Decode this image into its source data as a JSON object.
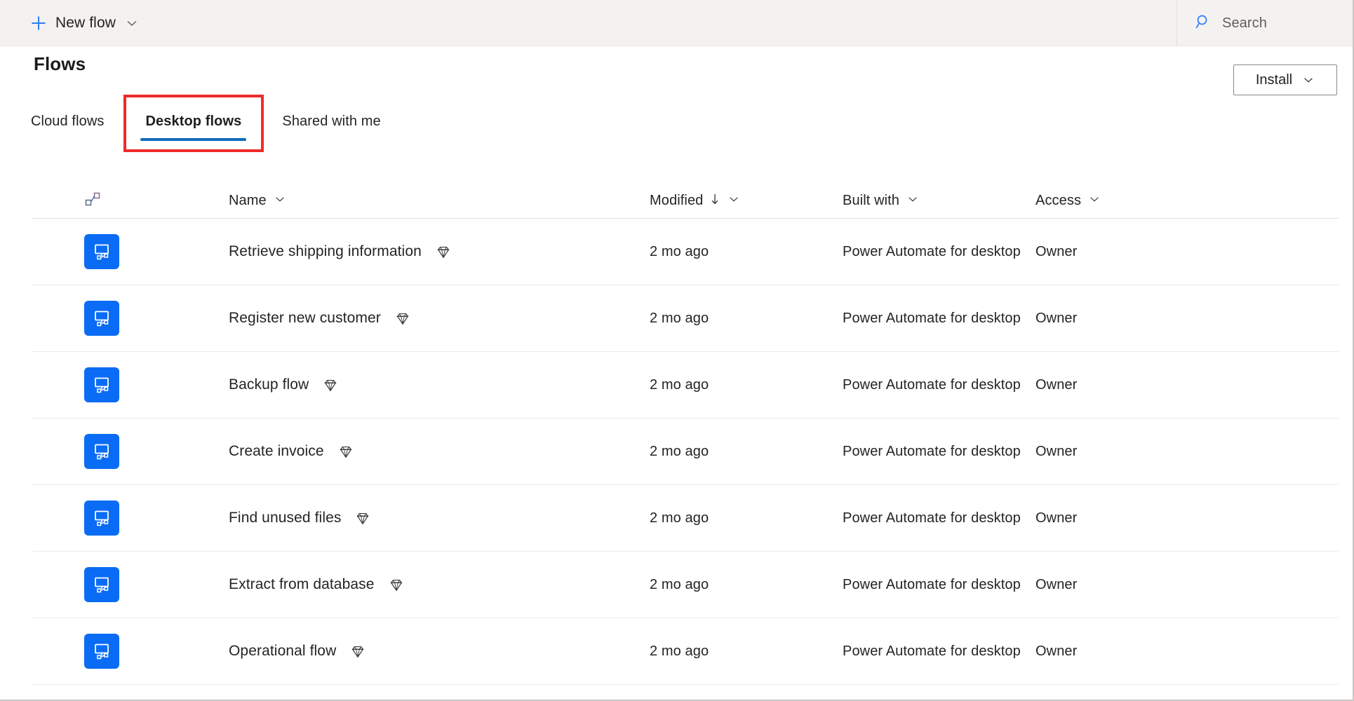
{
  "commandbar": {
    "new_flow_label": "New flow",
    "new_flow_icon": "plus-icon",
    "new_flow_chevron": "chevron-down-icon",
    "search_icon": "search-icon",
    "search_placeholder": "Search",
    "search_value": ""
  },
  "header": {
    "title": "Flows",
    "install_label": "Install",
    "install_chevron": "chevron-down-icon"
  },
  "tabs": [
    {
      "label": "Cloud flows",
      "active": false
    },
    {
      "label": "Desktop flows",
      "active": true,
      "highlighted": true
    },
    {
      "label": "Shared with me",
      "active": false
    }
  ],
  "table": {
    "columns": [
      {
        "key": "icon",
        "label": "",
        "icon": "flow-connector-icon",
        "sortable": false
      },
      {
        "key": "name",
        "label": "Name",
        "chevron": "chevron-down-icon",
        "sortable": true
      },
      {
        "key": "modified",
        "label": "Modified",
        "sort": "descending",
        "sort_icon": "arrow-down-icon",
        "chevron": "chevron-down-icon",
        "sortable": true
      },
      {
        "key": "built_with",
        "label": "Built with",
        "chevron": "chevron-down-icon",
        "sortable": true
      },
      {
        "key": "access",
        "label": "Access",
        "chevron": "chevron-down-icon",
        "sortable": true
      }
    ],
    "rows": [
      {
        "icon": "desktop-flow-icon",
        "name": "Retrieve shipping information",
        "premium": "premium-diamond-icon",
        "modified": "2 mo ago",
        "built_with": "Power Automate for desktop",
        "access": "Owner"
      },
      {
        "icon": "desktop-flow-icon",
        "name": "Register new customer",
        "premium": "premium-diamond-icon",
        "modified": "2 mo ago",
        "built_with": "Power Automate for desktop",
        "access": "Owner"
      },
      {
        "icon": "desktop-flow-icon",
        "name": "Backup flow",
        "premium": "premium-diamond-icon",
        "modified": "2 mo ago",
        "built_with": "Power Automate for desktop",
        "access": "Owner"
      },
      {
        "icon": "desktop-flow-icon",
        "name": "Create invoice",
        "premium": "premium-diamond-icon",
        "modified": "2 mo ago",
        "built_with": "Power Automate for desktop",
        "access": "Owner"
      },
      {
        "icon": "desktop-flow-icon",
        "name": "Find unused files",
        "premium": "premium-diamond-icon",
        "modified": "2 mo ago",
        "built_with": "Power Automate for desktop",
        "access": "Owner"
      },
      {
        "icon": "desktop-flow-icon",
        "name": "Extract from database",
        "premium": "premium-diamond-icon",
        "modified": "2 mo ago",
        "built_with": "Power Automate for desktop",
        "access": "Owner"
      },
      {
        "icon": "desktop-flow-icon",
        "name": "Operational flow",
        "premium": "premium-diamond-icon",
        "modified": "2 mo ago",
        "built_with": "Power Automate for desktop",
        "access": "Owner"
      }
    ]
  },
  "colors": {
    "accent_blue": "#0f6cbd",
    "icon_blue": "#0a6cf5",
    "plus_blue": "#2a7ef5",
    "highlight_red": "#ed2b2b",
    "commandbar_bg": "#f3f2f1",
    "text": "#242424",
    "muted_text": "#605e5c"
  }
}
